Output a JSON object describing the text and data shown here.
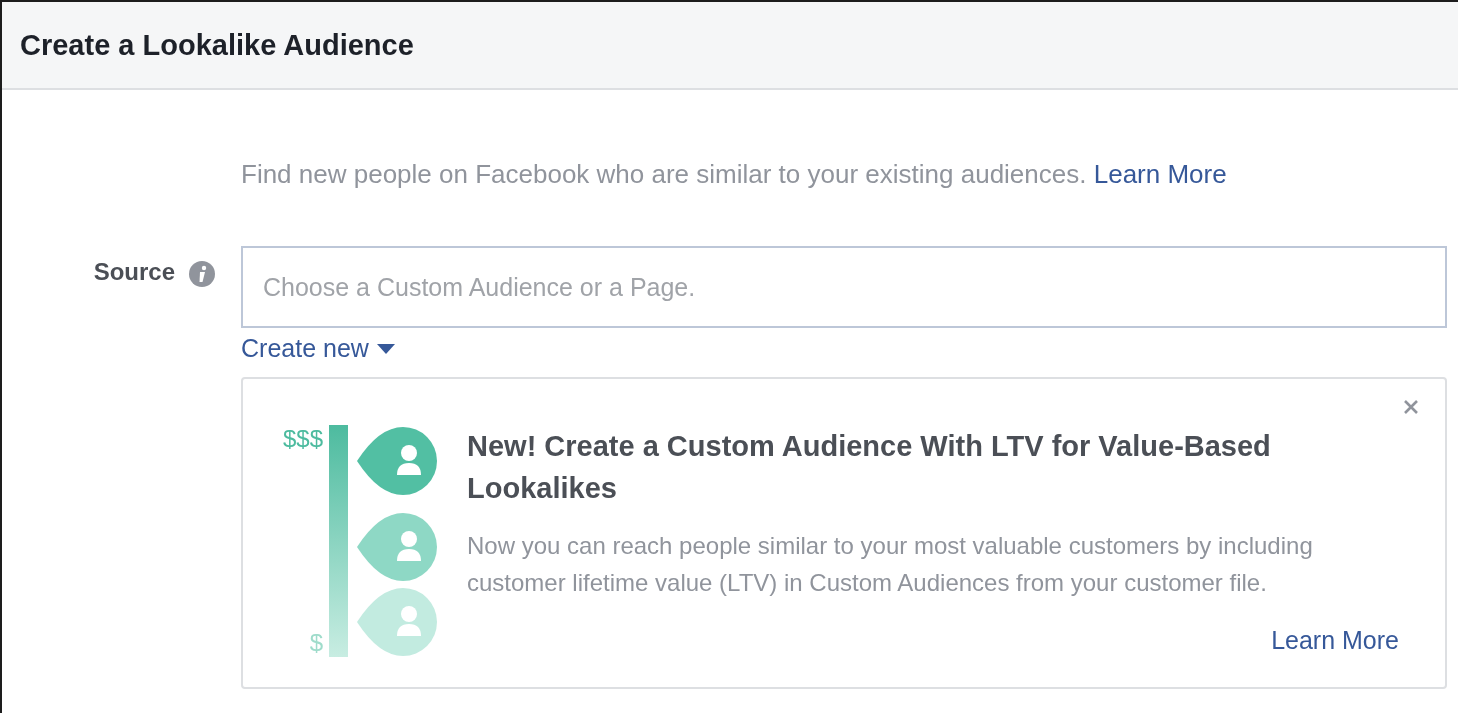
{
  "dialog": {
    "title": "Create a Lookalike Audience"
  },
  "intro": {
    "text": "Find new people on Facebook who are similar to your existing audiences.",
    "link": "Learn More"
  },
  "source": {
    "label": "Source",
    "placeholder": "Choose a Custom Audience or a Page.",
    "create_new": "Create new"
  },
  "promo": {
    "high_label": "$$$",
    "low_label": "$",
    "title": "New! Create a Custom Audience With LTV for Value-Based Lookalikes",
    "body": "Now you can reach people similar to your most valuable customers by including customer lifetime value (LTV) in Custom Audiences from your customer file.",
    "link": "Learn More"
  }
}
